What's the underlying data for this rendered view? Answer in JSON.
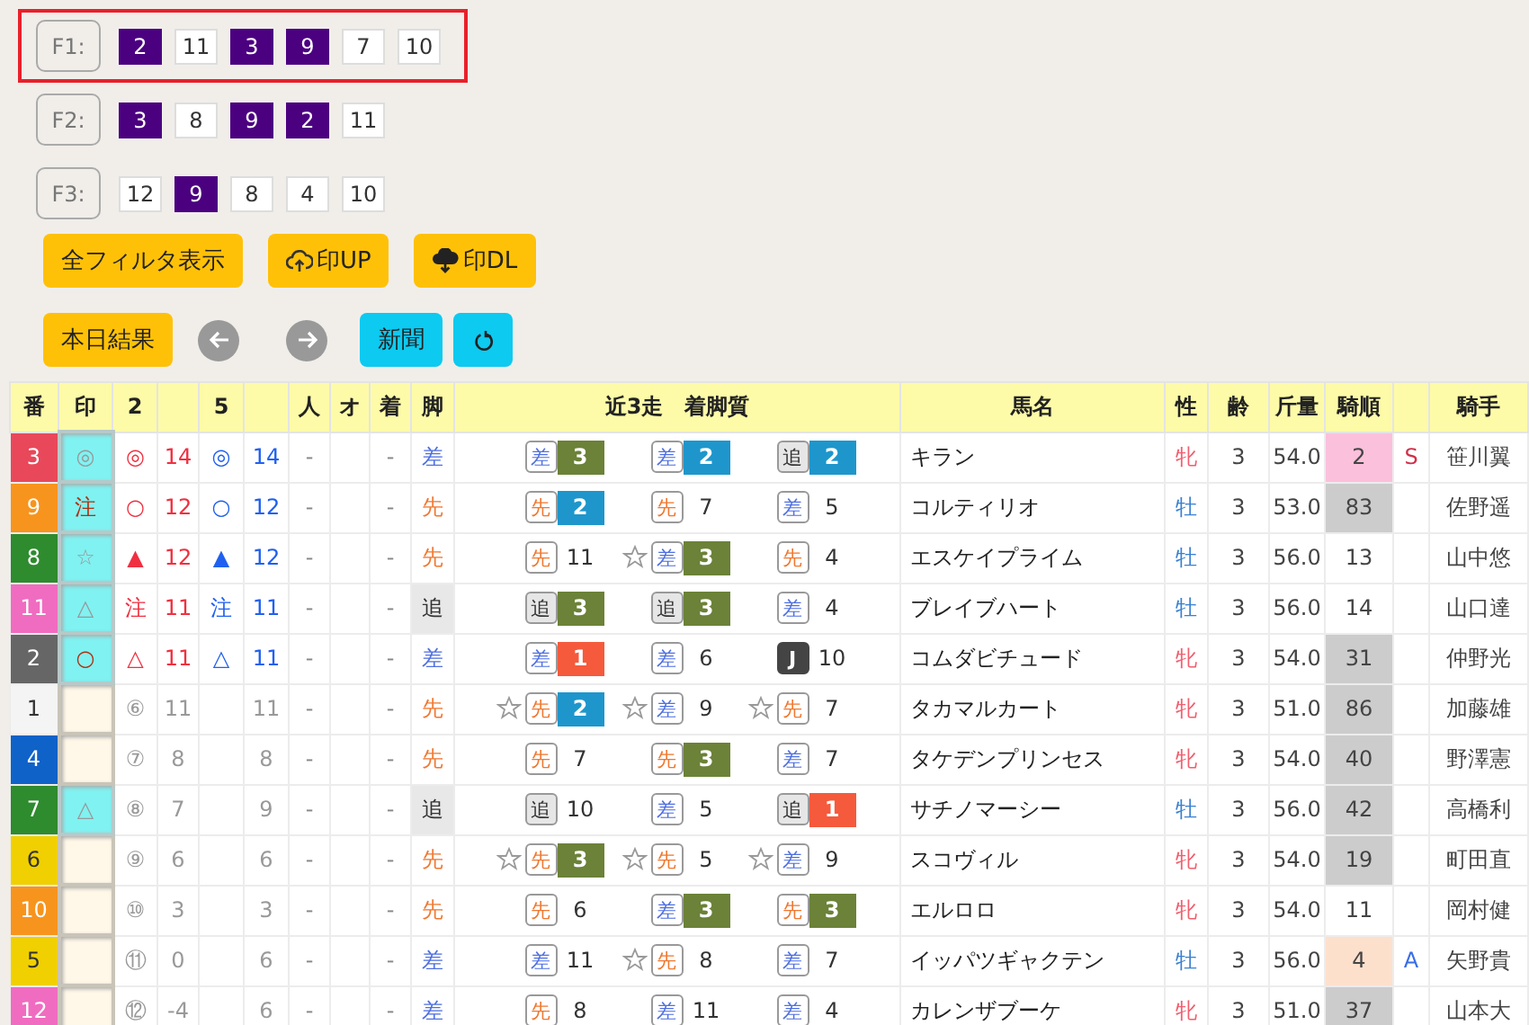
{
  "filters": [
    {
      "label": "F1:",
      "selected": true,
      "chips": [
        {
          "value": "2",
          "on": true
        },
        {
          "value": "11",
          "on": false
        },
        {
          "value": "3",
          "on": true
        },
        {
          "value": "9",
          "on": true
        },
        {
          "value": "7",
          "on": false
        },
        {
          "value": "10",
          "on": false
        }
      ]
    },
    {
      "label": "F2:",
      "selected": false,
      "chips": [
        {
          "value": "3",
          "on": true
        },
        {
          "value": "8",
          "on": false
        },
        {
          "value": "9",
          "on": true
        },
        {
          "value": "2",
          "on": true
        },
        {
          "value": "11",
          "on": false
        }
      ]
    },
    {
      "label": "F3:",
      "selected": false,
      "chips": [
        {
          "value": "12",
          "on": false
        },
        {
          "value": "9",
          "on": true
        },
        {
          "value": "8",
          "on": false
        },
        {
          "value": "4",
          "on": false
        },
        {
          "value": "10",
          "on": false
        }
      ]
    }
  ],
  "toolbar": [
    [
      {
        "kind": "filter",
        "label": "全フィルタ表示"
      },
      {
        "kind": "upload",
        "label": "印UP"
      },
      {
        "kind": "download",
        "label": "印DL"
      }
    ],
    [
      {
        "kind": "result",
        "label": "本日結果"
      },
      {
        "kind": "prev"
      },
      {
        "kind": "next"
      },
      {
        "kind": "news",
        "label": "新聞"
      },
      {
        "kind": "refresh"
      }
    ]
  ],
  "table": {
    "columns": [
      {
        "label": "番"
      },
      {
        "label": "印"
      },
      {
        "label": "2"
      },
      {},
      {
        "label": "5"
      },
      {},
      {
        "label": "人"
      },
      {
        "label": "オ"
      },
      {
        "label": "着"
      },
      {
        "label": "脚"
      },
      {
        "label": "近3走　着脚質"
      },
      {
        "label": "馬名"
      },
      {
        "label": "性"
      },
      {
        "label": "齢"
      },
      {
        "label": "斤量"
      },
      {
        "label": "騎順"
      },
      {},
      {
        "label": "騎手"
      }
    ],
    "rows": [
      {
        "num": "3",
        "color": "#e8485a",
        "mark": {
          "text": "◎",
          "kind": "plain"
        },
        "c2_mark": "◎",
        "c2": "14",
        "c5_mark": "◎",
        "c5": "14",
        "highlight": true,
        "ninki": "-",
        "chaku": "-",
        "style": "差",
        "kind": "sashi",
        "runs": [
          {
            "star": false,
            "style": "差",
            "kind": "sashi",
            "finish": "3",
            "color": "#6b8238"
          },
          {
            "star": false,
            "style": "差",
            "kind": "sashi",
            "finish": "2",
            "color": "#1e96cc"
          },
          {
            "star": false,
            "style": "追",
            "kind": "oikomi",
            "finish": "2",
            "color": "#1e96cc"
          }
        ],
        "name": "キラン",
        "sex": {
          "text": "牝",
          "kind": "female"
        },
        "age": "3",
        "weight": "54.0",
        "rank": {
          "text": "2",
          "color": "#fbc0dc"
        },
        "grade": {
          "text": "S",
          "color": "#d0304a"
        },
        "jockey": "笹川翼"
      },
      {
        "num": "9",
        "color": "#f7941d",
        "mark": {
          "text": "注",
          "kind": "strong"
        },
        "c2_mark": "○",
        "c2": "12",
        "c5_mark": "○",
        "c5": "12",
        "highlight": true,
        "ninki": "-",
        "chaku": "-",
        "style": "先",
        "kind": "senko",
        "runs": [
          {
            "star": false,
            "style": "先",
            "kind": "senko",
            "finish": "2",
            "color": "#1e96cc"
          },
          {
            "star": false,
            "style": "先",
            "kind": "senko",
            "finish": "7"
          },
          {
            "star": false,
            "style": "差",
            "kind": "sashi",
            "finish": "5"
          }
        ],
        "name": "コルティリオ",
        "sex": {
          "text": "牡",
          "kind": "male"
        },
        "age": "3",
        "weight": "53.0",
        "rank": {
          "text": "83",
          "color": "#cccccc"
        },
        "jockey": "佐野遥"
      },
      {
        "num": "8",
        "color": "#2e8b2e",
        "mark": {
          "text": "☆",
          "kind": "plain"
        },
        "c2_mark": "▲",
        "c2": "12",
        "c5_mark": "▲",
        "c5": "12",
        "highlight": true,
        "ninki": "-",
        "chaku": "-",
        "style": "先",
        "kind": "senko",
        "runs": [
          {
            "star": false,
            "style": "先",
            "kind": "senko",
            "finish": "11"
          },
          {
            "star": true,
            "style": "差",
            "kind": "sashi",
            "finish": "3",
            "color": "#6b8238"
          },
          {
            "star": false,
            "style": "先",
            "kind": "senko",
            "finish": "4"
          }
        ],
        "name": "エスケイプライム",
        "sex": {
          "text": "牡",
          "kind": "male"
        },
        "age": "3",
        "weight": "56.0",
        "rank": {
          "text": "13"
        },
        "jockey": "山中悠"
      },
      {
        "num": "11",
        "color": "#f06cc0",
        "mark": {
          "text": "△",
          "kind": "plain"
        },
        "c2_mark": "注",
        "c2": "11",
        "c5_mark": "注",
        "c5": "11",
        "highlight": true,
        "ninki": "-",
        "chaku": "-",
        "style": "追",
        "kind": "oikomi",
        "runs": [
          {
            "star": false,
            "style": "追",
            "kind": "oikomi",
            "finish": "3",
            "color": "#6b8238"
          },
          {
            "star": false,
            "style": "追",
            "kind": "oikomi",
            "finish": "3",
            "color": "#6b8238"
          },
          {
            "star": false,
            "style": "差",
            "kind": "sashi",
            "finish": "4"
          }
        ],
        "name": "ブレイブハート",
        "sex": {
          "text": "牡",
          "kind": "male"
        },
        "age": "3",
        "weight": "56.0",
        "rank": {
          "text": "14"
        },
        "jockey": "山口達"
      },
      {
        "num": "2",
        "color": "#666666",
        "mark": {
          "text": "○",
          "kind": "strong"
        },
        "c2_mark": "△",
        "c2": "11",
        "c5_mark": "△",
        "c5": "11",
        "highlight": true,
        "ninki": "-",
        "chaku": "-",
        "style": "差",
        "kind": "sashi",
        "runs": [
          {
            "star": false,
            "style": "差",
            "kind": "sashi",
            "finish": "1",
            "color": "#f55a3c"
          },
          {
            "star": false,
            "style": "差",
            "kind": "sashi",
            "finish": "6"
          },
          {
            "star": false,
            "style": "J",
            "kind": "jump",
            "finish": "10"
          }
        ],
        "name": "コムダビチュード",
        "sex": {
          "text": "牝",
          "kind": "female"
        },
        "age": "3",
        "weight": "54.0",
        "rank": {
          "text": "31",
          "color": "#cccccc"
        },
        "jockey": "仲野光"
      },
      {
        "num": "1",
        "color": "#f4f4f4",
        "c2_mark": "⑥",
        "c2": "11",
        "c5": "11",
        "highlight": false,
        "ninki": "-",
        "chaku": "-",
        "style": "先",
        "kind": "senko",
        "runs": [
          {
            "star": true,
            "style": "先",
            "kind": "senko",
            "finish": "2",
            "color": "#1e96cc"
          },
          {
            "star": true,
            "style": "差",
            "kind": "sashi",
            "finish": "9"
          },
          {
            "star": true,
            "style": "先",
            "kind": "senko",
            "finish": "7"
          }
        ],
        "name": "タカマルカート",
        "sex": {
          "text": "牝",
          "kind": "female"
        },
        "age": "3",
        "weight": "51.0",
        "rank": {
          "text": "86",
          "color": "#cccccc"
        },
        "jockey": "加藤雄"
      },
      {
        "num": "4",
        "color": "#0f62c8",
        "c2_mark": "⑦",
        "c2": "8",
        "c5": "8",
        "highlight": false,
        "ninki": "-",
        "chaku": "-",
        "style": "先",
        "kind": "senko",
        "runs": [
          {
            "star": false,
            "style": "先",
            "kind": "senko",
            "finish": "7"
          },
          {
            "star": false,
            "style": "先",
            "kind": "senko",
            "finish": "3",
            "color": "#6b8238"
          },
          {
            "star": false,
            "style": "差",
            "kind": "sashi",
            "finish": "7"
          }
        ],
        "name": "タケデンプリンセス",
        "sex": {
          "text": "牝",
          "kind": "female"
        },
        "age": "3",
        "weight": "54.0",
        "rank": {
          "text": "40",
          "color": "#cccccc"
        },
        "jockey": "野澤憲"
      },
      {
        "num": "7",
        "color": "#2e8b2e",
        "mark": {
          "text": "△",
          "kind": "plain"
        },
        "c2_mark": "⑧",
        "c2": "7",
        "c5": "9",
        "highlight": false,
        "ninki": "-",
        "chaku": "-",
        "style": "追",
        "kind": "oikomi",
        "runs": [
          {
            "star": false,
            "style": "追",
            "kind": "oikomi",
            "finish": "10"
          },
          {
            "star": false,
            "style": "差",
            "kind": "sashi",
            "finish": "5"
          },
          {
            "star": false,
            "style": "追",
            "kind": "oikomi",
            "finish": "1",
            "color": "#f55a3c"
          }
        ],
        "name": "サチノマーシー",
        "sex": {
          "text": "牡",
          "kind": "male"
        },
        "age": "3",
        "weight": "56.0",
        "rank": {
          "text": "42",
          "color": "#cccccc"
        },
        "jockey": "高橋利"
      },
      {
        "num": "6",
        "color": "#f0d000",
        "c2_mark": "⑨",
        "c2": "6",
        "c5": "6",
        "highlight": false,
        "ninki": "-",
        "chaku": "-",
        "style": "先",
        "kind": "senko",
        "runs": [
          {
            "star": true,
            "style": "先",
            "kind": "senko",
            "finish": "3",
            "color": "#6b8238"
          },
          {
            "star": true,
            "style": "先",
            "kind": "senko",
            "finish": "5"
          },
          {
            "star": true,
            "style": "差",
            "kind": "sashi",
            "finish": "9"
          }
        ],
        "name": "スコヴィル",
        "sex": {
          "text": "牝",
          "kind": "female"
        },
        "age": "3",
        "weight": "54.0",
        "rank": {
          "text": "19",
          "color": "#cccccc"
        },
        "jockey": "町田直"
      },
      {
        "num": "10",
        "color": "#f7941d",
        "c2_mark": "⑩",
        "c2": "3",
        "c5": "3",
        "highlight": false,
        "ninki": "-",
        "chaku": "-",
        "style": "先",
        "kind": "senko",
        "runs": [
          {
            "star": false,
            "style": "先",
            "kind": "senko",
            "finish": "6"
          },
          {
            "star": false,
            "style": "差",
            "kind": "sashi",
            "finish": "3",
            "color": "#6b8238"
          },
          {
            "star": false,
            "style": "先",
            "kind": "senko",
            "finish": "3",
            "color": "#6b8238"
          }
        ],
        "name": "エルロロ",
        "sex": {
          "text": "牝",
          "kind": "female"
        },
        "age": "3",
        "weight": "54.0",
        "rank": {
          "text": "11"
        },
        "jockey": "岡村健"
      },
      {
        "num": "5",
        "color": "#f0d000",
        "c2_mark": "⑪",
        "c2": "0",
        "c5": "6",
        "highlight": false,
        "ninki": "-",
        "chaku": "-",
        "style": "差",
        "kind": "sashi",
        "runs": [
          {
            "star": false,
            "style": "差",
            "kind": "sashi",
            "finish": "11"
          },
          {
            "star": true,
            "style": "先",
            "kind": "senko",
            "finish": "8"
          },
          {
            "star": false,
            "style": "差",
            "kind": "sashi",
            "finish": "7"
          }
        ],
        "name": "イッパツギャクテン",
        "sex": {
          "text": "牡",
          "kind": "male"
        },
        "age": "3",
        "weight": "56.0",
        "rank": {
          "text": "4",
          "color": "#fde0cc"
        },
        "grade": {
          "text": "A",
          "color": "#3a6ee8"
        },
        "jockey": "矢野貴"
      },
      {
        "num": "12",
        "color": "#f06cc0",
        "c2_mark": "⑫",
        "c2": "-4",
        "c5": "6",
        "highlight": false,
        "ninki": "-",
        "chaku": "-",
        "style": "差",
        "kind": "sashi",
        "runs": [
          {
            "star": false,
            "style": "先",
            "kind": "senko",
            "finish": "8"
          },
          {
            "star": false,
            "style": "差",
            "kind": "sashi",
            "finish": "11"
          },
          {
            "star": false,
            "style": "差",
            "kind": "sashi",
            "finish": "4"
          }
        ],
        "name": "カレンザブーケ",
        "sex": {
          "text": "牝",
          "kind": "female"
        },
        "age": "3",
        "weight": "51.0",
        "rank": {
          "text": "37",
          "color": "#cccccc"
        },
        "jockey": "山本大"
      }
    ]
  }
}
